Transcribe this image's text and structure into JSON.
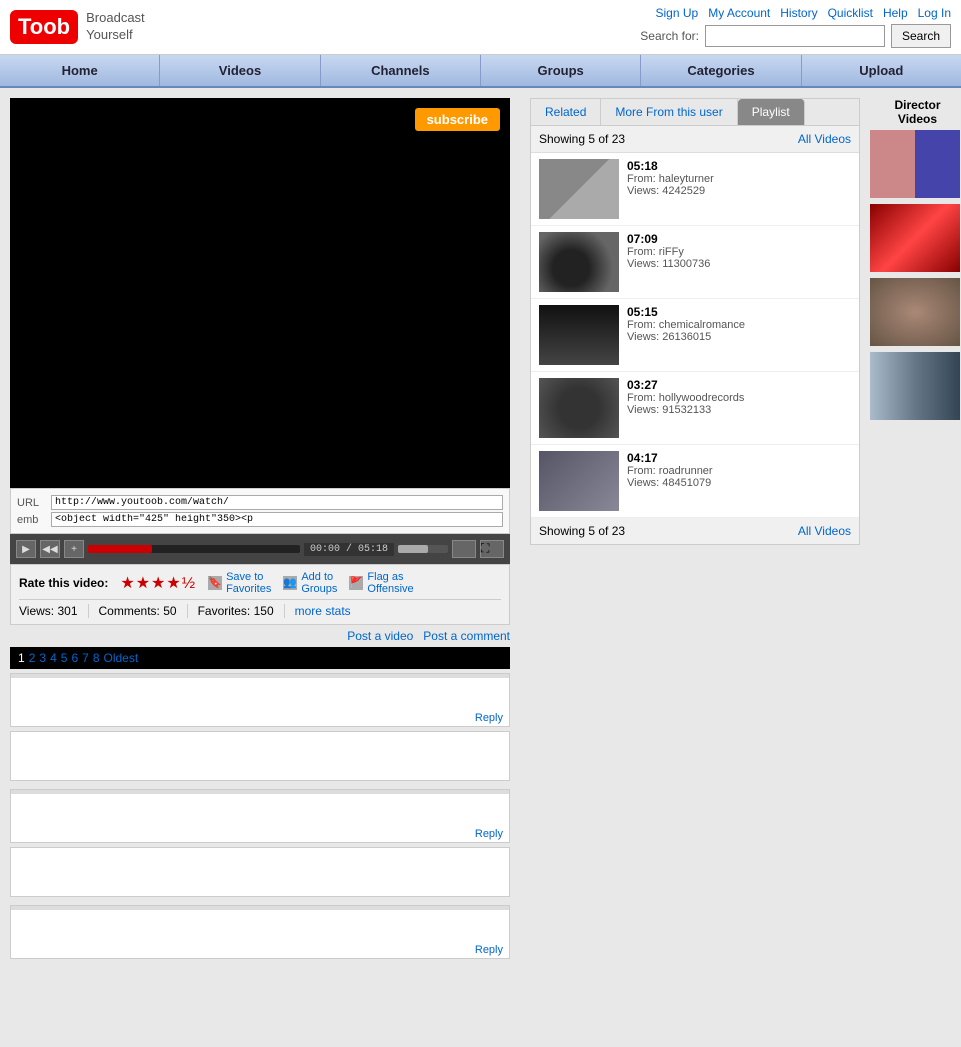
{
  "header": {
    "logo": "Toob",
    "tagline": "Broadcast\nYourself",
    "top_links": [
      "Sign Up",
      "My Account",
      "History",
      "Quicklist",
      "Help",
      "Log In"
    ],
    "search_label": "Search for:",
    "search_placeholder": "",
    "search_button": "Search"
  },
  "navbar": {
    "items": [
      "Home",
      "Videos",
      "Channels",
      "Groups",
      "Categories",
      "Upload"
    ]
  },
  "video": {
    "subscribe_label": "subscribe",
    "url_label": "URL",
    "url_value": "http://www.youtoob.com/watch/",
    "emb_label": "emb",
    "emb_value": "<object width=\"425\" height\"350><p",
    "controls": {
      "play": "▶",
      "prev": "◀◀",
      "plus": "+",
      "time": "00:00 / 05:18",
      "fullscreen": "⛶"
    },
    "rate_label": "Rate this video:",
    "stars": "★★★★½",
    "actions": [
      {
        "icon": "bookmark-icon",
        "label": "Save to\nFavorites"
      },
      {
        "icon": "group-icon",
        "label": "Add to\nGroups"
      },
      {
        "icon": "flag-icon",
        "label": "Flag as\nOffensive"
      }
    ],
    "stats": {
      "views_label": "Views:",
      "views": "301",
      "comments_label": "Comments:",
      "comments": "50",
      "favorites_label": "Favorites:",
      "favorites": "150",
      "more_stats": "more stats"
    },
    "post_video": "Post a video",
    "post_comment": "Post a comment",
    "pagination": [
      "2",
      "3",
      "4",
      "5",
      "6",
      "7",
      "8",
      "Oldest"
    ]
  },
  "playlist": {
    "tabs": [
      "Related",
      "More From this user",
      "Playlist"
    ],
    "active_tab": "Playlist",
    "showing": "Showing 5 of 23",
    "all_videos": "All Videos",
    "items": [
      {
        "duration": "05:18",
        "from": "From: haleyturner",
        "views": "Views: 4242529"
      },
      {
        "duration": "07:09",
        "from": "From: riFFy",
        "views": "Views: 11300736"
      },
      {
        "duration": "05:15",
        "from": "From: chemicalromance",
        "views": "Views: 26136015"
      },
      {
        "duration": "03:27",
        "from": "From: hollywoodrecords",
        "views": "Views: 91532133"
      },
      {
        "duration": "04:17",
        "from": "From: roadrunner",
        "views": "Views: 48451079"
      }
    ],
    "footer_showing": "Showing 5 of 23",
    "footer_all_videos": "All Videos"
  },
  "director": {
    "title": "Director\nVideos",
    "thumbs": 4
  },
  "comments": [
    {
      "header": "",
      "body": "",
      "reply": "Reply"
    },
    {
      "header": "",
      "body": "",
      "reply": "Reply"
    },
    {
      "header": "",
      "body": "",
      "reply": "Reply"
    }
  ]
}
